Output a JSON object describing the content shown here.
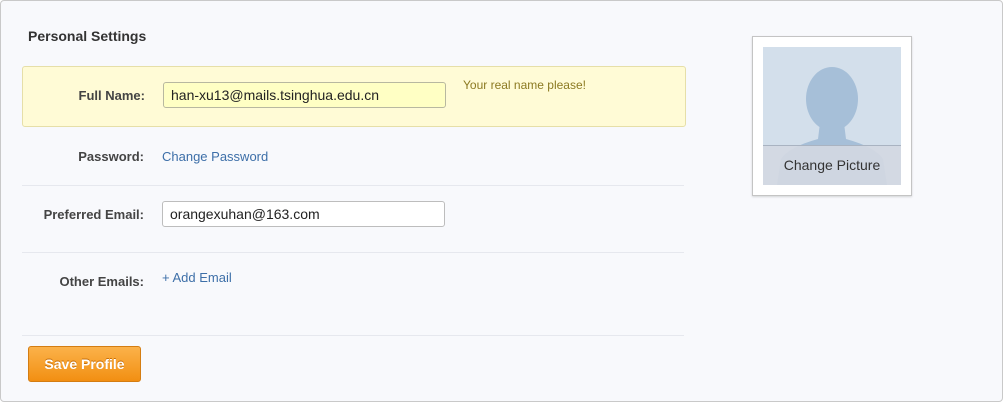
{
  "section": {
    "title": "Personal Settings"
  },
  "fields": {
    "full_name": {
      "label": "Full Name:",
      "value": "han-xu13@mails.tsinghua.edu.cn",
      "hint": "Your real name please!"
    },
    "password": {
      "label": "Password:",
      "link": "Change Password"
    },
    "preferred_email": {
      "label": "Preferred Email:",
      "value": "orangexuhan@163.com"
    },
    "other_emails": {
      "label": "Other Emails:",
      "link": "+ Add Email"
    }
  },
  "actions": {
    "save_label": "Save Profile"
  },
  "picture": {
    "change_label": "Change Picture"
  },
  "colors": {
    "accent_orange": "#f6a12e",
    "link_blue": "#3d6fa8",
    "highlight_yellow": "#fffbd6",
    "avatar_blue": "#a6bfd8"
  },
  "icons": {
    "avatar": "avatar-silhouette-icon"
  }
}
